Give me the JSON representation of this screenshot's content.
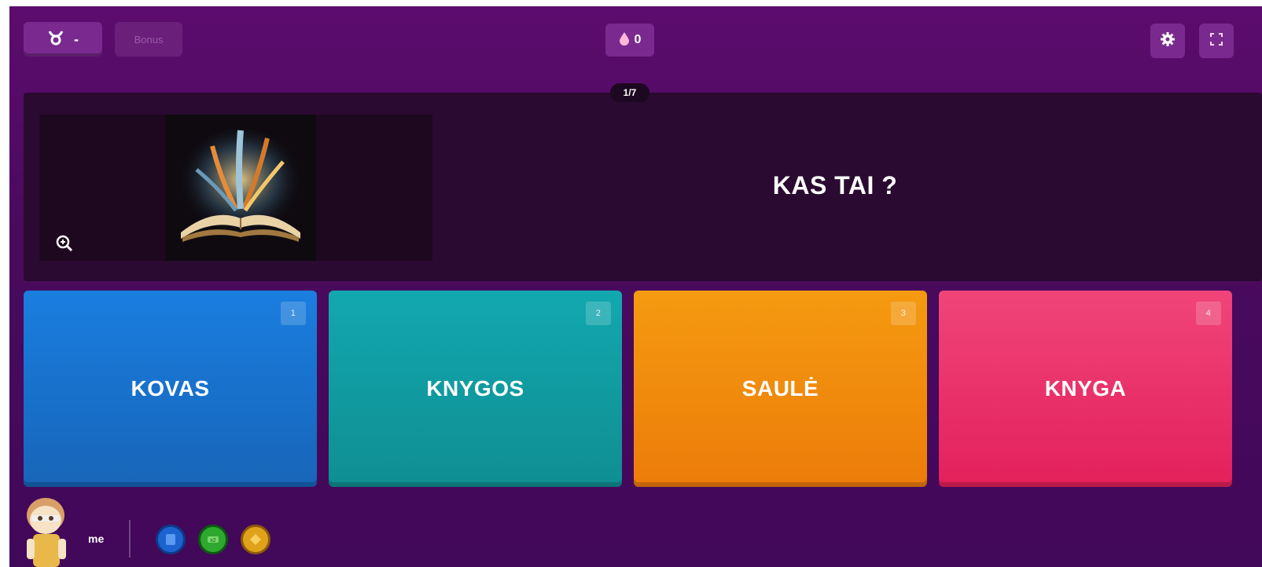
{
  "topbar": {
    "streak_label": "-",
    "bonus_label": "Bonus",
    "points_value": "0",
    "icons": {
      "streak": "taurus-icon",
      "points": "drop-icon",
      "settings": "gear-icon",
      "fullscreen": "fullscreen-icon"
    }
  },
  "question": {
    "counter": "1/7",
    "text": "KAS TAI ?",
    "zoom_icon": "zoom-in-icon"
  },
  "answers": [
    {
      "number": "1",
      "label": "KOVAS",
      "color": "#1a7ee0"
    },
    {
      "number": "2",
      "label": "KNYGOS",
      "color": "#12a8b0"
    },
    {
      "number": "3",
      "label": "SAULĖ",
      "color": "#f59a10"
    },
    {
      "number": "4",
      "label": "KNYGA",
      "color": "#f0457a"
    }
  ],
  "player": {
    "name": "me",
    "powerups": [
      "blue-powerup-icon",
      "green-powerup-icon",
      "gold-powerup-icon"
    ]
  },
  "colors": {
    "background": "#4a0a5c",
    "panel": "#2a0a30",
    "button": "#7a2a8e"
  }
}
